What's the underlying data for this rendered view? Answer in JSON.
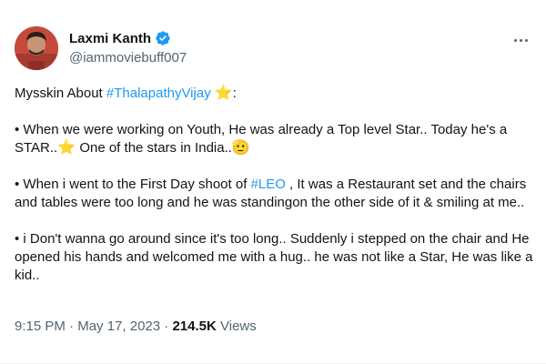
{
  "author": {
    "display_name": "Laxmi Kanth",
    "handle": "@iammoviebuff007",
    "verified_icon": "verified-badge-icon"
  },
  "colors": {
    "link": "#1d9bf0",
    "secondary_text": "#536471",
    "primary_text": "#0f1419"
  },
  "tweet": {
    "intro_prefix": "Mysskin About ",
    "intro_hashtag": "#ThalapathyVijay",
    "intro_emoji": "⭐",
    "intro_suffix": ":",
    "p1_text": "• When we were working on Youth, He was already a Top level Star.. Today he's a STAR..",
    "p1_emoji": "⭐",
    "p1_text2": " One of the stars in India..",
    "p1_emoji2": "🫡",
    "p2_prefix": "• When i went to the First Day shoot of ",
    "p2_hashtag": "#LEO",
    "p2_suffix": " , It was a Restaurant set and the chairs and tables were too long and he was standingon the other side of it & smiling at me..",
    "p3_text": "• i Don't wanna go around since it's too long.. Suddenly i stepped on the chair and He opened his hands and welcomed me with a hug.. he was not like a Star, He was like a kid.."
  },
  "meta": {
    "time": "9:15 PM",
    "separator1": " · ",
    "date": "May 17, 2023",
    "separator2": " · ",
    "views_count": "214.5K",
    "views_label": " Views"
  }
}
